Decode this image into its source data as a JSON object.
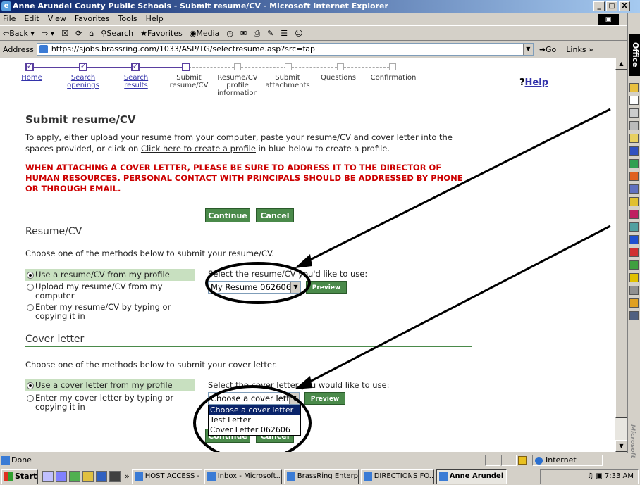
{
  "window": {
    "title": "Anne Arundel County Public Schools - Submit resume/CV - Microsoft Internet Explorer",
    "buttons": [
      "_",
      "□",
      "X"
    ]
  },
  "menu": [
    "File",
    "Edit",
    "View",
    "Favorites",
    "Tools",
    "Help"
  ],
  "toolbar": {
    "back": "⇦Back ▾",
    "forward": "⇨ ▾",
    "search": "Search",
    "favorites": "Favorites",
    "media": "Media"
  },
  "address": {
    "label": "Address",
    "url": "https://sjobs.brassring.com/1033/ASP/TG/selectresume.asp?src=fap",
    "go": "Go",
    "links": "Links »"
  },
  "office_label": "Office",
  "office_side": "Microsoft",
  "wizard": {
    "steps": [
      {
        "label": "Home",
        "link": true
      },
      {
        "label": "Search openings",
        "link": true
      },
      {
        "label": "Search results",
        "link": true
      },
      {
        "label": "Submit resume/CV",
        "link": false
      },
      {
        "label": "Resume/CV profile information",
        "link": false
      },
      {
        "label": "Submit attachments",
        "link": false
      },
      {
        "label": "Questions",
        "link": false
      },
      {
        "label": "Confirmation",
        "link": false
      }
    ],
    "help": "Help",
    "help_mark": "?"
  },
  "page": {
    "title": "Submit resume/CV",
    "intro_a": "To apply, either upload your resume from your computer, paste your resume/CV and cover letter into the spaces provided, or click on",
    "intro_link": "Click here to create a profile",
    "intro_b": "in blue below to create a profile.",
    "warning": "WHEN ATTACHING A COVER LETTER, PLEASE BE SURE TO ADDRESS IT TO THE DIRECTOR OF HUMAN RESOURCES. PERSONAL CONTACT WITH PRINCIPALS SHOULD BE ADDRESSED BY PHONE OR THROUGH EMAIL.",
    "continue": "Continue",
    "cancel": "Cancel"
  },
  "resume": {
    "heading": "Resume/CV",
    "prompt": "Choose one of the methods below to submit your resume/CV.",
    "options": [
      "Use a resume/CV from my profile",
      "Upload my resume/CV from my computer",
      "Enter my resume/CV by typing or copying it in"
    ],
    "select_label": "Select the resume/CV you'd like to use:",
    "selected": "My Resume 062606",
    "preview": "Preview"
  },
  "cover": {
    "heading": "Cover letter",
    "prompt": "Choose one of the methods below to submit your cover letter.",
    "options": [
      "Use a cover letter from my profile",
      "Enter my cover letter by typing or copying it in"
    ],
    "select_label": "Select the cover letter you would like to use:",
    "selected": "Choose a cover letter",
    "list": [
      "Choose a cover letter",
      "Test Letter",
      "Cover Letter 062606"
    ],
    "preview": "Preview",
    "continue": "Continue",
    "cancel": "Cancel"
  },
  "status": {
    "text": "Done",
    "zone": "Internet"
  },
  "taskbar": {
    "start": "Start",
    "tasks": [
      "HOST ACCESS - ...",
      "Inbox - Microsoft...",
      "BrassRing Enterp...",
      "DIRECTIONS FO...",
      "Anne Arundel C..."
    ],
    "time": "7:33 AM",
    "overflow": "»"
  }
}
